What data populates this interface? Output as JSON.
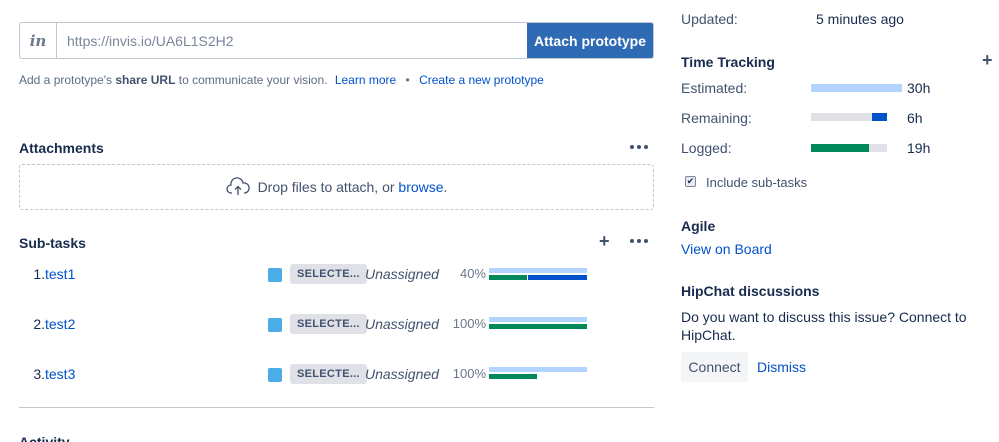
{
  "prototype": {
    "icon": "invision-icon",
    "url_placeholder": "https://invis.io/UA6L1S2H2",
    "attach_label": "Attach prototype",
    "help_prefix": "Add a prototype's",
    "help_bold": "share URL",
    "help_suffix": "to communicate your vision.",
    "learn_more": "Learn more",
    "bullet": "•",
    "create_new": "Create a new prototype"
  },
  "attachments": {
    "title": "Attachments",
    "drop_text": "Drop files to attach, or",
    "browse": "browse",
    "period": ".",
    "icon": "cloud-upload-icon"
  },
  "subtasks": {
    "title": "Sub-tasks",
    "items": [
      {
        "num": "1.",
        "name": "test1",
        "status": "SELECTE...",
        "assignee": "Unassigned",
        "percent": "40%",
        "progress": 0.4
      },
      {
        "num": "2.",
        "name": "test2",
        "status": "SELECTE...",
        "assignee": "Unassigned",
        "percent": "100%",
        "progress": 1.0
      },
      {
        "num": "3.",
        "name": "test3",
        "status": "SELECTE...",
        "assignee": "Unassigned",
        "percent": "100%",
        "progress": 1.0
      }
    ]
  },
  "activity": {
    "title": "Activity"
  },
  "dates": {
    "updated_label": "Updated:",
    "updated_value": "5 minutes ago"
  },
  "time_tracking": {
    "title": "Time Tracking",
    "estimated_label": "Estimated:",
    "estimated_value": "30h",
    "estimated_fraction": 1.0,
    "remaining_label": "Remaining:",
    "remaining_value": "6h",
    "remaining_fraction": 0.2,
    "logged_label": "Logged:",
    "logged_value": "19h",
    "logged_fraction": 0.76,
    "include_subtasks": "Include sub-tasks",
    "include_checked": true,
    "colors": {
      "estimated": "#b3d4ff",
      "remaining": "#0052cc",
      "logged": "#00875a",
      "track": "#dfe1e6"
    }
  },
  "agile": {
    "title": "Agile",
    "view_on_board": "View on Board"
  },
  "hipchat": {
    "title": "HipChat discussions",
    "text_line1": "Do you want to discuss this issue? Connect to",
    "text_line2": "HipChat.",
    "connect": "Connect",
    "dismiss": "Dismiss"
  }
}
